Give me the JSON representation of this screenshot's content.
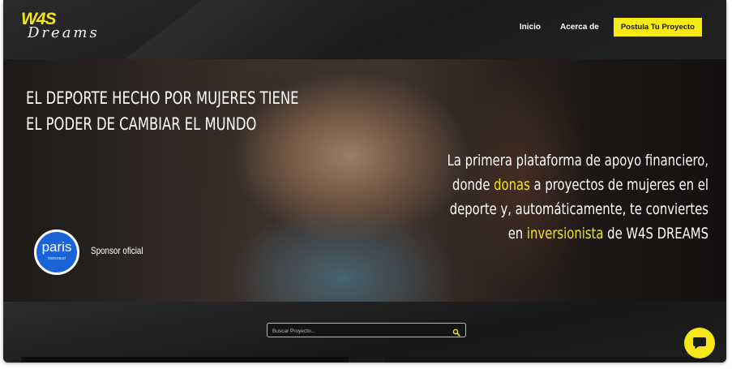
{
  "header": {
    "logo_main": "W4S",
    "logo_script": "Dreams",
    "nav": [
      {
        "label": "Inicio"
      },
      {
        "label": "Acerca de"
      }
    ],
    "cta_label": "Postula Tu Proyecto"
  },
  "hero": {
    "title_line1": "EL DEPORTE HECHO POR MUJERES TIENE",
    "title_line2": "EL PODER DE CAMBIAR EL MUNDO",
    "sub": {
      "line1": "La primera plataforma de apoyo financiero,",
      "line2_pre": "donde ",
      "line2_hl": "donas",
      "line2_post": " a proyectos de mujeres en el",
      "line3": "deporte y, automáticamente, te conviertes",
      "line4_pre": "en ",
      "line4_hl": "inversionista",
      "line4_post": " de W4S DREAMS"
    },
    "sponsor_brand": "paris",
    "sponsor_brand_sub": "bancosud",
    "sponsor_text": "Sponsor oficial"
  },
  "search": {
    "placeholder": "Buscar Proyecto...",
    "icon": "search-icon"
  },
  "chat": {
    "icon": "chat-icon"
  },
  "colors": {
    "accent": "#f7ea17",
    "dark": "#1e1e1e"
  }
}
